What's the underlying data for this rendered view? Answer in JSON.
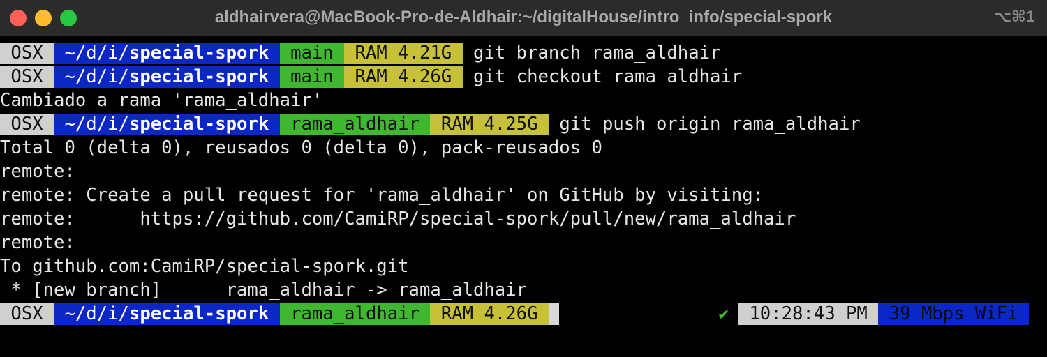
{
  "window": {
    "title": "aldhairvera@MacBook-Pro-de-Aldhair:~/digitalHouse/intro_info/special-spork",
    "shortcut": "⌥⌘1"
  },
  "prompt": {
    "os": "OSX",
    "dir_prefix": "~/d/i/",
    "dir_name": "special-spork"
  },
  "lines": [
    {
      "type": "prompt",
      "branch": "main",
      "ram": "RAM 4.21G",
      "command": "git branch rama_aldhair"
    },
    {
      "type": "prompt",
      "branch": "main",
      "ram": "RAM 4.26G",
      "command": "git checkout rama_aldhair"
    },
    {
      "type": "output",
      "text": "Cambiado a rama 'rama_aldhair'"
    },
    {
      "type": "prompt",
      "branch": "rama_aldhair",
      "ram": "RAM 4.25G",
      "command": "git push origin rama_aldhair"
    },
    {
      "type": "output",
      "text": "Total 0 (delta 0), reusados 0 (delta 0), pack-reusados 0"
    },
    {
      "type": "output",
      "text": "remote:"
    },
    {
      "type": "output",
      "text": "remote: Create a pull request for 'rama_aldhair' on GitHub by visiting:"
    },
    {
      "type": "output",
      "text": "remote:      https://github.com/CamiRP/special-spork/pull/new/rama_aldhair"
    },
    {
      "type": "output",
      "text": "remote:"
    },
    {
      "type": "output",
      "text": "To github.com:CamiRP/special-spork.git"
    },
    {
      "type": "output",
      "text": " * [new branch]      rama_aldhair -> rama_aldhair"
    }
  ],
  "current_prompt": {
    "branch": "rama_aldhair",
    "ram": "RAM 4.26G",
    "status_icon": "✔",
    "time": "10:28:43 PM",
    "network": "39 Mbps WiFi"
  }
}
